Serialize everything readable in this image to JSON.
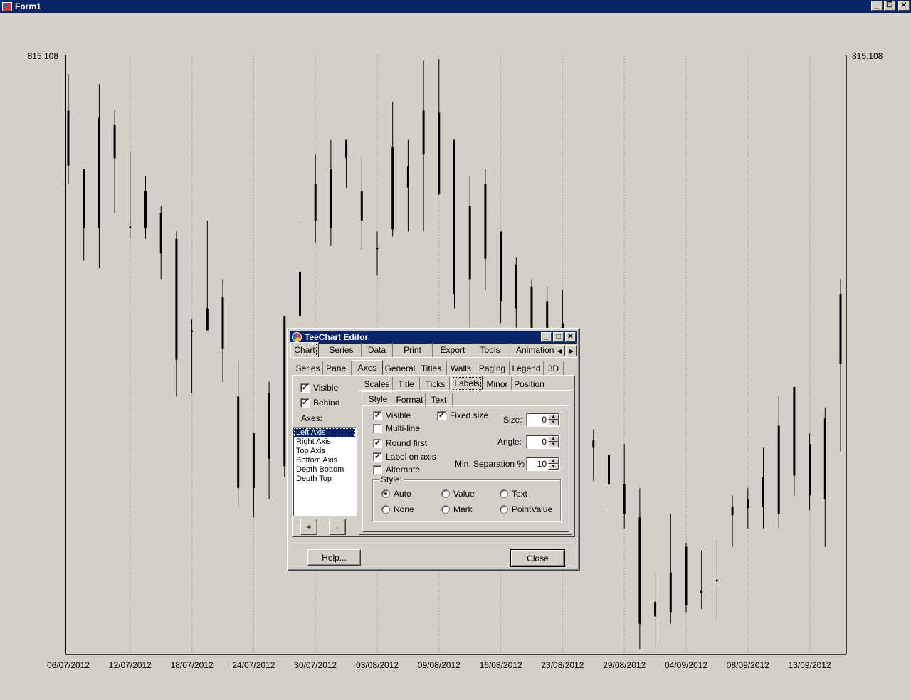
{
  "window": {
    "title": "Form1"
  },
  "chart_data": {
    "type": "candlestick",
    "title": "",
    "axis_top_label_left": "815.108",
    "axis_top_label_right": "815.108",
    "x_labels": [
      "06/07/2012",
      "12/07/2012",
      "18/07/2012",
      "24/07/2012",
      "30/07/2012",
      "03/08/2012",
      "09/08/2012",
      "16/08/2012",
      "23/08/2012",
      "29/08/2012",
      "04/09/2012",
      "08/09/2012",
      "13/09/2012"
    ],
    "ylim": [
      0,
      815.108
    ],
    "candles": [
      {
        "x": 0,
        "o": 740,
        "c": 665,
        "h": 790,
        "l": 640
      },
      {
        "x": 1,
        "o": 660,
        "c": 580,
        "h": 660,
        "l": 535
      },
      {
        "x": 2,
        "o": 730,
        "c": 580,
        "h": 776,
        "l": 525
      },
      {
        "x": 3,
        "o": 720,
        "c": 675,
        "h": 740,
        "l": 600
      },
      {
        "x": 4,
        "o": 582,
        "c": 580,
        "h": 685,
        "l": 565
      },
      {
        "x": 5,
        "o": 630,
        "c": 580,
        "h": 650,
        "l": 565
      },
      {
        "x": 6,
        "o": 600,
        "c": 545,
        "h": 610,
        "l": 510
      },
      {
        "x": 7,
        "o": 565,
        "c": 400,
        "h": 575,
        "l": 350
      },
      {
        "x": 8,
        "o": 440,
        "c": 438,
        "h": 455,
        "l": 355
      },
      {
        "x": 9,
        "o": 470,
        "c": 440,
        "h": 590,
        "l": 445
      },
      {
        "x": 10,
        "o": 485,
        "c": 415,
        "h": 510,
        "l": 370
      },
      {
        "x": 11,
        "o": 350,
        "c": 225,
        "h": 400,
        "l": 200
      },
      {
        "x": 12,
        "o": 300,
        "c": 225,
        "h": 300,
        "l": 185
      },
      {
        "x": 13,
        "o": 355,
        "c": 265,
        "h": 370,
        "l": 210
      },
      {
        "x": 14,
        "o": 460,
        "c": 255,
        "h": 460,
        "l": 240
      },
      {
        "x": 15,
        "o": 520,
        "c": 460,
        "h": 590,
        "l": 440
      },
      {
        "x": 16,
        "o": 640,
        "c": 590,
        "h": 680,
        "l": 560
      },
      {
        "x": 17,
        "o": 660,
        "c": 580,
        "h": 700,
        "l": 555
      },
      {
        "x": 18,
        "o": 700,
        "c": 675,
        "h": 700,
        "l": 635
      },
      {
        "x": 19,
        "o": 630,
        "c": 590,
        "h": 675,
        "l": 550
      },
      {
        "x": 20,
        "o": 553,
        "c": 551,
        "h": 575,
        "l": 515
      },
      {
        "x": 21,
        "o": 690,
        "c": 578,
        "h": 752,
        "l": 568
      },
      {
        "x": 22,
        "o": 664,
        "c": 635,
        "h": 700,
        "l": 575
      },
      {
        "x": 23,
        "o": 740,
        "c": 680,
        "h": 808,
        "l": 575
      },
      {
        "x": 24,
        "o": 737,
        "c": 626,
        "h": 810,
        "l": 625
      },
      {
        "x": 25,
        "o": 700,
        "c": 490,
        "h": 700,
        "l": 470
      },
      {
        "x": 26,
        "o": 610,
        "c": 510,
        "h": 650,
        "l": 440
      },
      {
        "x": 27,
        "o": 640,
        "c": 538,
        "h": 660,
        "l": 495
      },
      {
        "x": 28,
        "o": 575,
        "c": 480,
        "h": 575,
        "l": 450
      },
      {
        "x": 29,
        "o": 530,
        "c": 470,
        "h": 540,
        "l": 440
      },
      {
        "x": 30,
        "o": 500,
        "c": 440,
        "h": 510,
        "l": 420
      },
      {
        "x": 31,
        "o": 480,
        "c": 430,
        "h": 500,
        "l": 400
      },
      {
        "x": 32,
        "o": 450,
        "c": 420,
        "h": 495,
        "l": 380
      },
      {
        "x": 33,
        "o": 370,
        "c": 290,
        "h": 400,
        "l": 270
      },
      {
        "x": 34,
        "o": 290,
        "c": 280,
        "h": 305,
        "l": 235
      },
      {
        "x": 35,
        "o": 270,
        "c": 230,
        "h": 285,
        "l": 195
      },
      {
        "x": 36,
        "o": 230,
        "c": 190,
        "h": 285,
        "l": 170
      },
      {
        "x": 37,
        "o": 185,
        "c": 40,
        "h": 225,
        "l": 5
      },
      {
        "x": 38,
        "o": 70,
        "c": 50,
        "h": 107,
        "l": 8
      },
      {
        "x": 39,
        "o": 110,
        "c": 55,
        "h": 190,
        "l": 40
      },
      {
        "x": 40,
        "o": 145,
        "c": 65,
        "h": 150,
        "l": 55
      },
      {
        "x": 41,
        "o": 85,
        "c": 82,
        "h": 140,
        "l": 60
      },
      {
        "x": 42,
        "o": 100,
        "c": 98,
        "h": 155,
        "l": 45
      },
      {
        "x": 43,
        "o": 200,
        "c": 188,
        "h": 215,
        "l": 145
      },
      {
        "x": 44,
        "o": 210,
        "c": 198,
        "h": 225,
        "l": 170
      },
      {
        "x": 45,
        "o": 240,
        "c": 200,
        "h": 280,
        "l": 170
      },
      {
        "x": 46,
        "o": 310,
        "c": 190,
        "h": 350,
        "l": 170
      },
      {
        "x": 47,
        "o": 363,
        "c": 242,
        "h": 363,
        "l": 215
      },
      {
        "x": 48,
        "o": 285,
        "c": 215,
        "h": 300,
        "l": 195
      },
      {
        "x": 49,
        "o": 320,
        "c": 210,
        "h": 335,
        "l": 145
      },
      {
        "x": 50,
        "o": 490,
        "c": 395,
        "h": 510,
        "l": 275
      }
    ]
  },
  "editor": {
    "title": "TeeChart Editor",
    "top_tabs": [
      "Chart",
      "Series",
      "Data",
      "Print",
      "Export",
      "Tools",
      "Animations"
    ],
    "chart_tabs": [
      "Series",
      "Panel",
      "Axes",
      "General",
      "Titles",
      "Walls",
      "Paging",
      "Legend",
      "3D"
    ],
    "axes_tabs": [
      "Scales",
      "Title",
      "Ticks",
      "Labels",
      "Minor",
      "Position"
    ],
    "labels_tabs": [
      "Style",
      "Format",
      "Text"
    ],
    "visible": "Visible",
    "behind": "Behind",
    "axes_label": "Axes:",
    "axes_list": [
      "Left Axis",
      "Right Axis",
      "Top Axis",
      "Bottom Axis",
      "Depth Bottom",
      "Depth Top"
    ],
    "add_btn": "+",
    "remove_btn": "-",
    "labels": {
      "visible": "Visible",
      "multiline": "Multi-line",
      "round_first": "Round first",
      "label_on_axis": "Label on axis",
      "alternate": "Alternate",
      "fixed_size": "Fixed size",
      "size_label": "Size:",
      "size_value": "0",
      "angle_label": "Angle:",
      "angle_value": "0",
      "minsep_label": "Min. Separation %",
      "minsep_value": "10",
      "style_group": "Style:",
      "radio_auto": "Auto",
      "radio_value": "Value",
      "radio_text": "Text",
      "radio_none": "None",
      "radio_mark": "Mark",
      "radio_pointvalue": "PointValue"
    },
    "help_btn": "Help...",
    "close_btn": "Close"
  }
}
